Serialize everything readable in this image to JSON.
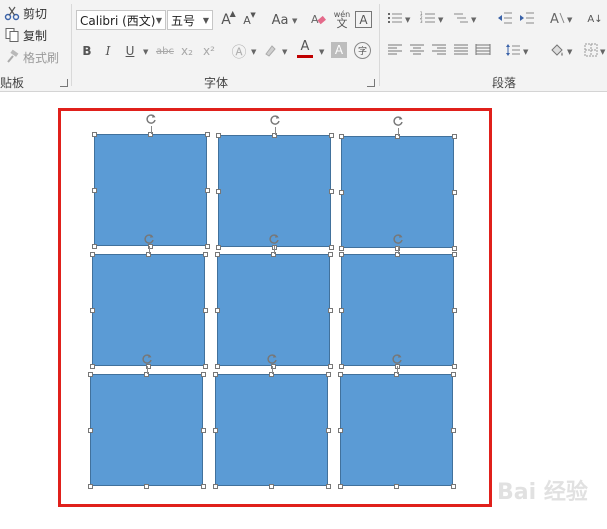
{
  "clipboard": {
    "cut_label": "剪切",
    "copy_label": "复制",
    "format_painter_label": "格式刷",
    "group_label": "贴板"
  },
  "font": {
    "name_value": "Calibri (西文)",
    "size_value": "五号",
    "group_label": "字体",
    "wen_glyph": "wén",
    "char_a": "A",
    "grow_label": "A",
    "shrink_label": "A",
    "case_label": "Aa",
    "bold_label": "B",
    "italic_label": "I",
    "underline_label": "U",
    "strike_label": "abc",
    "subscript_label": "x₂",
    "superscript_label": "x²",
    "font_color": "#c00000",
    "shade_label": "A",
    "enclose_label": "字"
  },
  "paragraph": {
    "group_label": "段落"
  },
  "shapes": {
    "fill_color": "#5b9bd5",
    "border_color": "#41719c",
    "selection_color": "#e0201b"
  },
  "watermark": {
    "text": "Bai 经验"
  }
}
